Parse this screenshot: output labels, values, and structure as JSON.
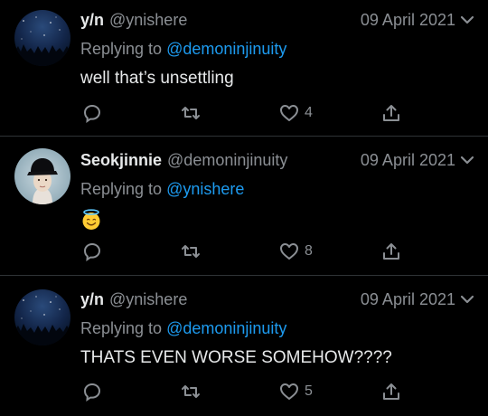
{
  "colors": {
    "background": "#000000",
    "text": "#e7e9ea",
    "muted": "#8b8f94",
    "mention": "#1d9bf0",
    "divider": "#2f3336"
  },
  "tweets": [
    {
      "name": "y/n",
      "handle": "@ynishere",
      "date": "09 April 2021",
      "replying_prefix": "Replying to",
      "replying_to": "@demoninjinuity",
      "text": "well that’s unsettling",
      "likes": "4",
      "avatar": "night-sky-forest-avatar"
    },
    {
      "name": "Seokjinnie",
      "handle": "@demoninjinuity",
      "date": "09 April 2021",
      "replying_prefix": "Replying to",
      "replying_to": "@ynishere",
      "text": "",
      "emoji": "halo-smiling-face-emoji",
      "likes": "8",
      "avatar": "person-black-cap-avatar"
    },
    {
      "name": "y/n",
      "handle": "@ynishere",
      "date": "09 April 2021",
      "replying_prefix": "Replying to",
      "replying_to": "@demoninjinuity",
      "text": "THATS EVEN WORSE SOMEHOW????",
      "likes": "5",
      "avatar": "night-sky-forest-avatar"
    }
  ]
}
